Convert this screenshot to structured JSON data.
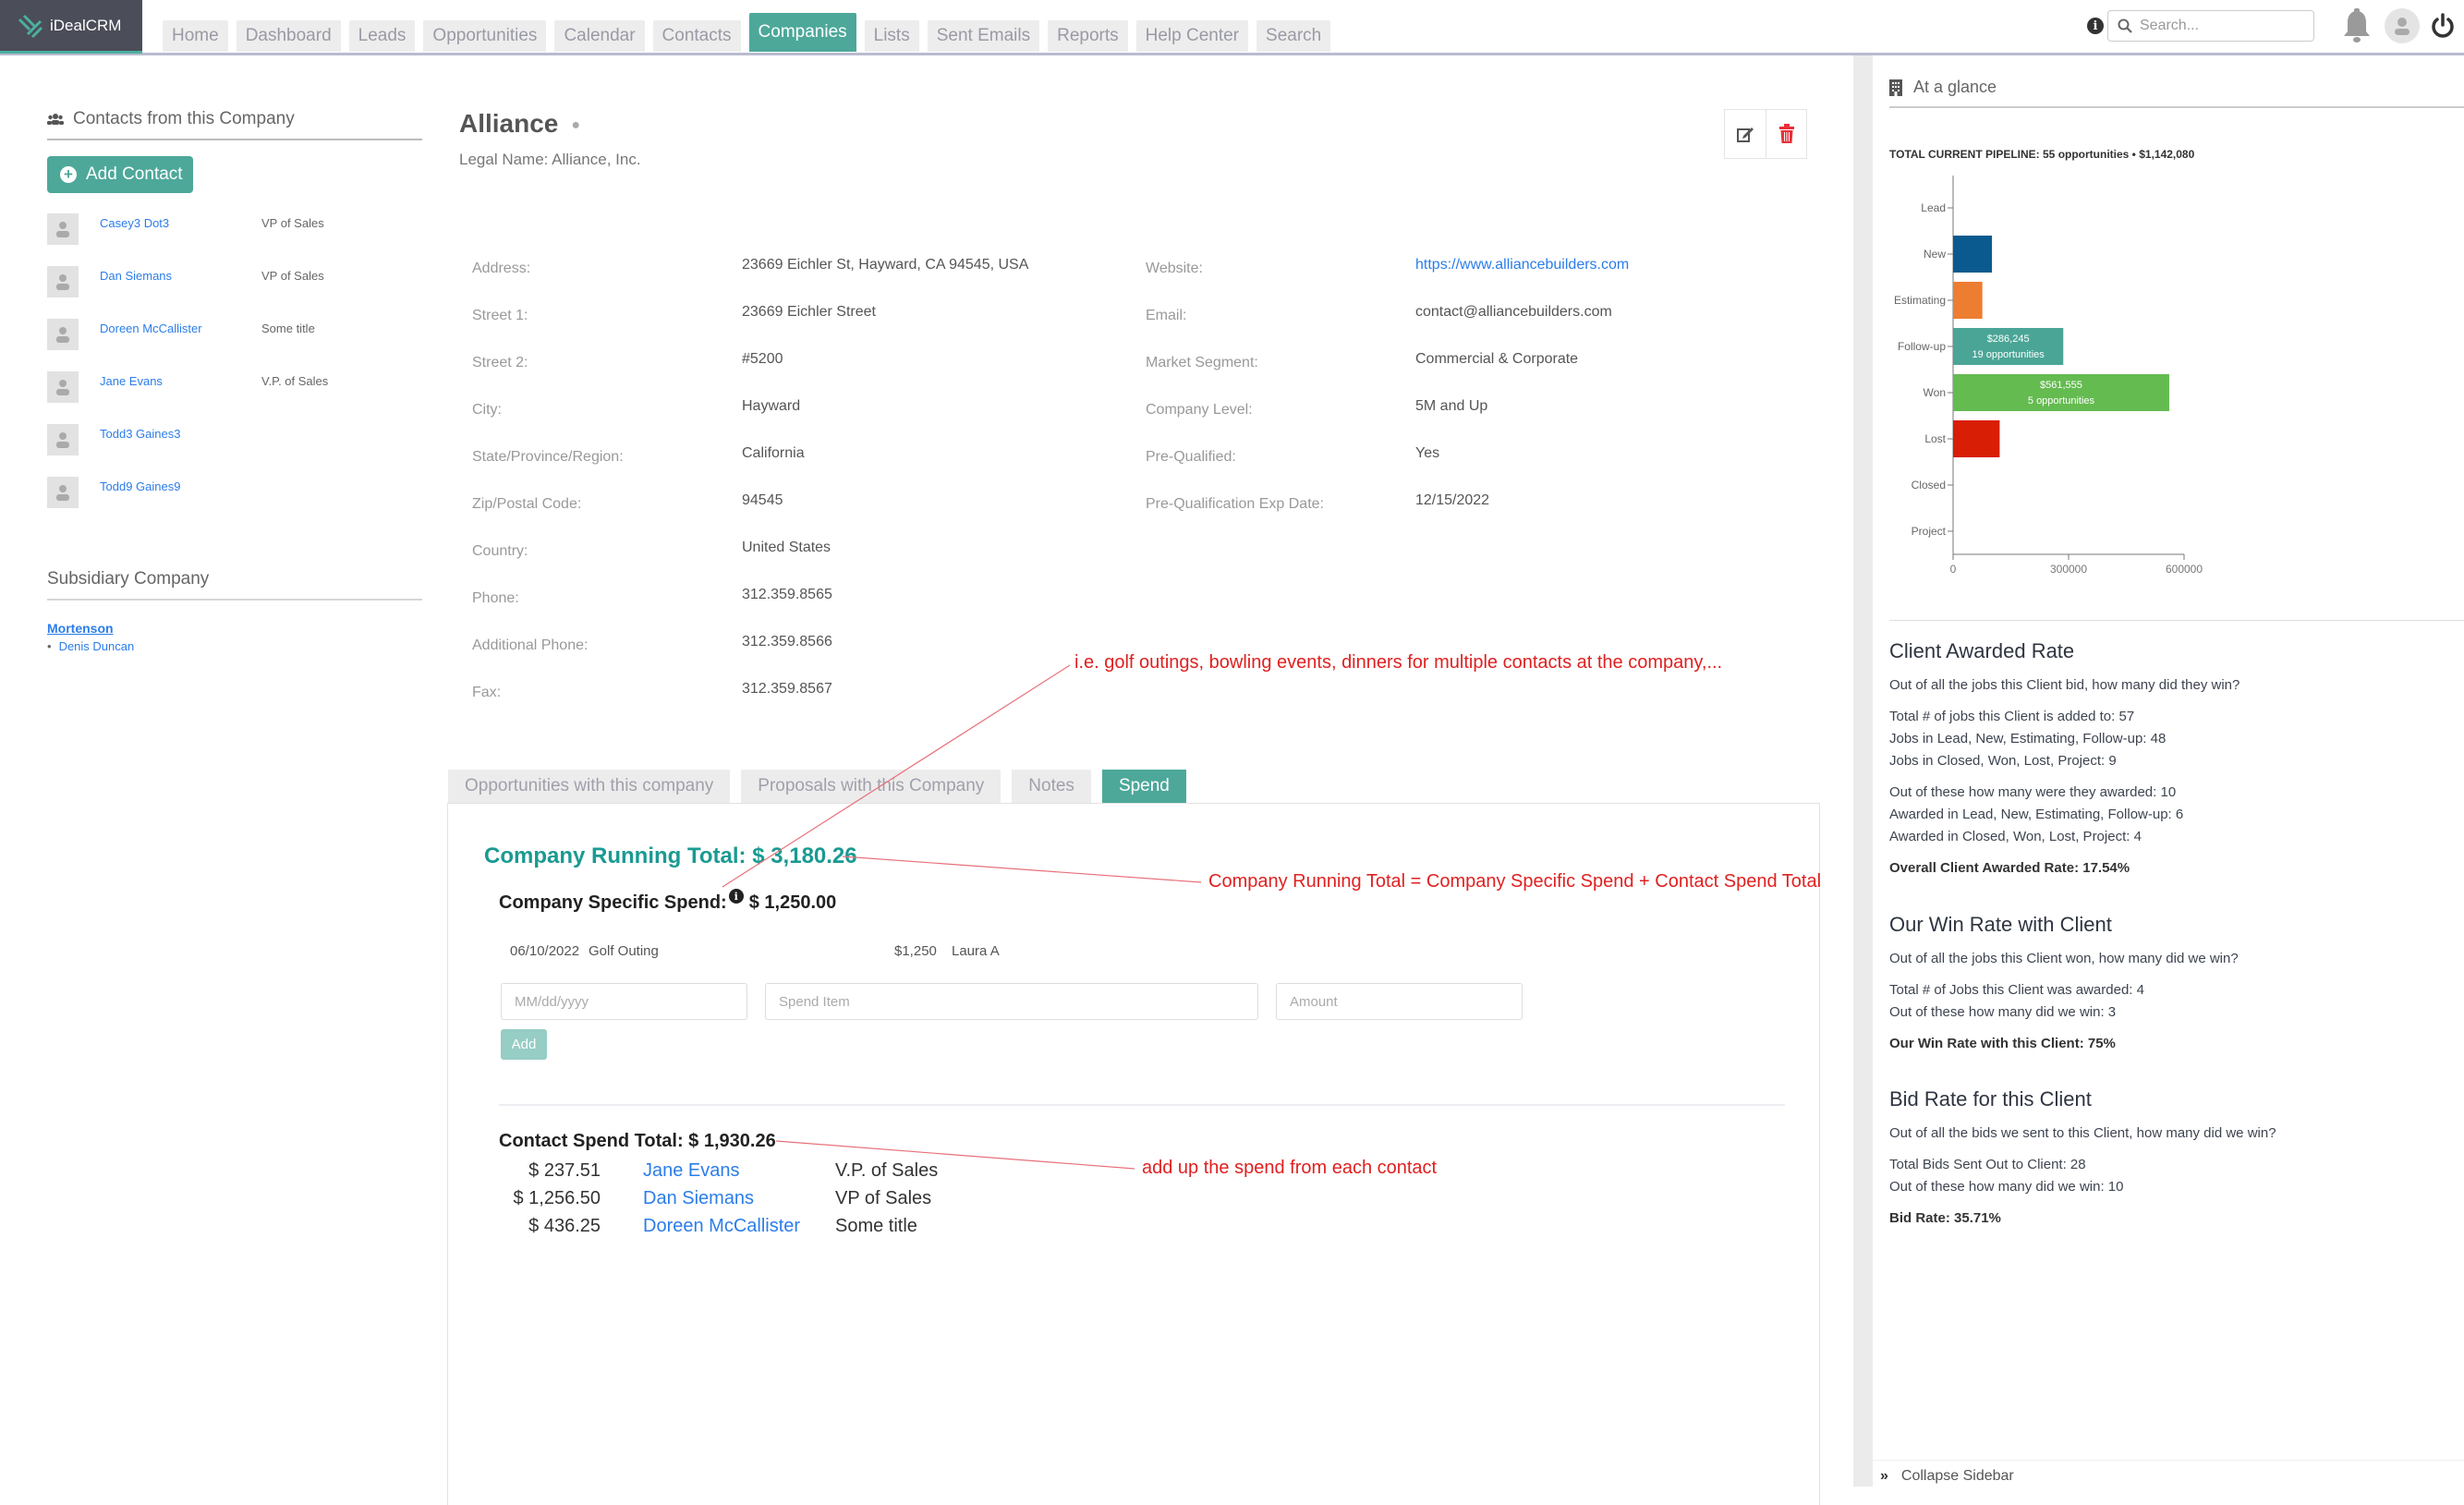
{
  "app": {
    "name": "iDealCRM"
  },
  "nav": {
    "tabs": [
      "Home",
      "Dashboard",
      "Leads",
      "Opportunities",
      "Calendar",
      "Contacts",
      "Companies",
      "Lists",
      "Sent Emails",
      "Reports",
      "Help Center",
      "Search"
    ],
    "active": "Companies",
    "search_placeholder": "Search..."
  },
  "contacts_panel": {
    "title": "Contacts from this Company",
    "add_label": "Add Contact",
    "contacts": [
      {
        "name": "Casey3 Dot3",
        "title": "VP of Sales"
      },
      {
        "name": "Dan Siemans",
        "title": "VP of Sales"
      },
      {
        "name": "Doreen McCallister",
        "title": "Some title"
      },
      {
        "name": "Jane Evans",
        "title": "V.P. of Sales"
      },
      {
        "name": "Todd3 Gaines3",
        "title": ""
      },
      {
        "name": "Todd9 Gaines9",
        "title": ""
      }
    ]
  },
  "subsidiary": {
    "title": "Subsidiary Company",
    "company": "Mortenson",
    "contacts": [
      "Denis Duncan"
    ]
  },
  "company": {
    "name": "Alliance",
    "legal_name": "Legal Name: Alliance, Inc.",
    "details_left": [
      {
        "label": "Address:",
        "value": "23669 Eichler St, Hayward, CA 94545, USA"
      },
      {
        "label": "Street 1:",
        "value": "23669 Eichler Street"
      },
      {
        "label": "Street 2:",
        "value": "#5200"
      },
      {
        "label": "City:",
        "value": "Hayward"
      },
      {
        "label": "State/Province/Region:",
        "value": "California"
      },
      {
        "label": "Zip/Postal Code:",
        "value": "94545"
      },
      {
        "label": "Country:",
        "value": "United States"
      },
      {
        "label": "Phone:",
        "value": "312.359.8565"
      },
      {
        "label": "Additional Phone:",
        "value": "312.359.8566"
      },
      {
        "label": "Fax:",
        "value": "312.359.8567"
      }
    ],
    "details_right": [
      {
        "label": "Website:",
        "value": "https://www.alliancebuilders.com",
        "link": true
      },
      {
        "label": "Email:",
        "value": "contact@alliancebuilders.com"
      },
      {
        "label": "Market Segment:",
        "value": "Commercial & Corporate"
      },
      {
        "label": "Company Level:",
        "value": "5M and Up"
      },
      {
        "label": "Pre-Qualified:",
        "value": "Yes"
      },
      {
        "label": "Pre-Qualification Exp Date:",
        "value": "12/15/2022"
      }
    ]
  },
  "annotations": {
    "golf": "i.e. golf outings, bowling events, dinners for multiple contacts at the company,...",
    "running": "Company Running Total = Company Specific Spend + Contact Spend Total",
    "contact": "add up the spend from each contact",
    "color": "#e02020"
  },
  "subtabs": {
    "items": [
      "Opportunities with this company",
      "Proposals with this Company",
      "Notes",
      "Spend"
    ],
    "active": "Spend"
  },
  "spend": {
    "running_total": "Company Running Total: $ 3,180.26",
    "specific_label": "Company Specific Spend:",
    "specific_value": "$ 1,250.00",
    "entries": [
      {
        "date": "06/10/2022",
        "item": "Golf Outing",
        "amount": "$1,250",
        "user": "Laura A"
      }
    ],
    "inputs": {
      "date_placeholder": "MM/dd/yyyy",
      "item_placeholder": "Spend Item",
      "amount_placeholder": "Amount"
    },
    "add_label": "Add",
    "contact_total": "Contact Spend Total: $ 1,930.26",
    "contact_spend": [
      {
        "amount": "$ 237.51",
        "name": "Jane Evans",
        "title": "V.P. of Sales"
      },
      {
        "amount": "$ 1,256.50",
        "name": "Dan Siemans",
        "title": "VP of Sales"
      },
      {
        "amount": "$ 436.25",
        "name": "Doreen McCallister",
        "title": "Some title"
      }
    ]
  },
  "sidebar": {
    "title": "At a glance",
    "pipeline": "TOTAL CURRENT PIPELINE: 55 opportunities • $1,142,080",
    "awarded": {
      "title": "Client Awarded Rate",
      "question": "Out of all the jobs this Client bid, how many did they win?",
      "lines1": [
        "Total # of jobs this Client is added to: 57",
        "Jobs in Lead, New, Estimating, Follow-up: 48",
        "Jobs in Closed, Won, Lost, Project: 9"
      ],
      "lines2": [
        "Out of these how many were they awarded: 10",
        "Awarded in Lead, New, Estimating, Follow-up: 6",
        "Awarded in Closed, Won, Lost, Project: 4"
      ],
      "result": "Overall Client Awarded Rate: 17.54%"
    },
    "winrate": {
      "title": "Our Win Rate with Client",
      "question": "Out of all the jobs this Client won, how many did we win?",
      "lines": [
        "Total # of Jobs this Client was awarded: 4",
        "Out of these how many did we win: 3"
      ],
      "result": "Our Win Rate with this Client: 75%"
    },
    "bidrate": {
      "title": "Bid Rate for this Client",
      "question": "Out of all the bids we sent to this Client, how many did we win?",
      "lines": [
        "Total Bids Sent Out to Client: 28",
        "Out of these how many did we win: 10"
      ],
      "result": "Bid Rate: 35.71%"
    },
    "collapse_label": "Collapse Sidebar"
  },
  "chart_data": {
    "type": "bar",
    "orientation": "horizontal",
    "title": "",
    "categories": [
      "Lead",
      "New",
      "Estimating",
      "Follow-up",
      "Won",
      "Lost",
      "Closed",
      "Project"
    ],
    "values": [
      0,
      101000,
      76000,
      286245,
      561555,
      121000,
      0,
      0
    ],
    "colors": [
      "#0b5a8f",
      "#0b5a8f",
      "#ed7d31",
      "#4aa596",
      "#64bb50",
      "#d81e05",
      "#888888",
      "#888888"
    ],
    "data_labels": {
      "Follow-up": [
        "$286,245",
        "19 opportunities"
      ],
      "Won": [
        "$561,555",
        "5 opportunities"
      ]
    },
    "xticks": [
      "0",
      "300000",
      "600000"
    ],
    "xlim": [
      0,
      600000
    ],
    "grid": false,
    "xlabel": "",
    "ylabel": ""
  }
}
